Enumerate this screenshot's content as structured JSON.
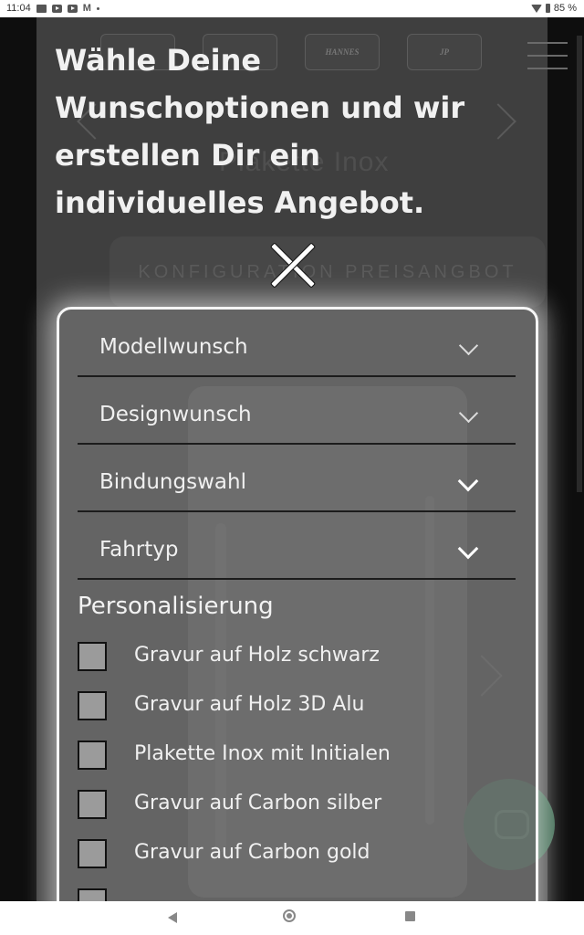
{
  "status_bar": {
    "time": "11:04",
    "battery": "85 %",
    "left_icons": [
      "image-icon",
      "youtube-icon",
      "youtube-icon",
      "gmail-icon",
      "dot-icon"
    ],
    "right_icons": [
      "wifi-icon",
      "battery-icon"
    ]
  },
  "background": {
    "logos": [
      "",
      "",
      "HANNES",
      "JP"
    ],
    "subtitle": "Plakette Inox",
    "config_button": "KONFIGURATION   PREISANGBOT"
  },
  "overlay": {
    "heading": "Wähle Deine Wunschoptionen und wir erstellen Dir ein individuelles Angebot.",
    "close_icon": "close-icon"
  },
  "form": {
    "selects": [
      {
        "label": "Modellwunsch"
      },
      {
        "label": "Designwunsch"
      },
      {
        "label": "Bindungswahl"
      },
      {
        "label": "Fahrtyp"
      }
    ],
    "personalization_title": "Personalisierung",
    "checkboxes": [
      {
        "label": "Gravur auf Holz schwarz",
        "checked": false
      },
      {
        "label": "Gravur auf Holz 3D Alu",
        "checked": false
      },
      {
        "label": "Plakette Inox mit Initialen",
        "checked": false
      },
      {
        "label": "Gravur auf Carbon silber",
        "checked": false
      },
      {
        "label": "Gravur auf Carbon gold",
        "checked": false
      },
      {
        "label": "",
        "checked": false
      }
    ]
  },
  "nav_bar": {
    "icons": [
      "back-icon",
      "home-icon",
      "recents-icon"
    ]
  },
  "colors": {
    "panel_border": "#f5f5f5",
    "overlay_bg": "#3f3f3f",
    "chat_button": "#3f6a52"
  }
}
